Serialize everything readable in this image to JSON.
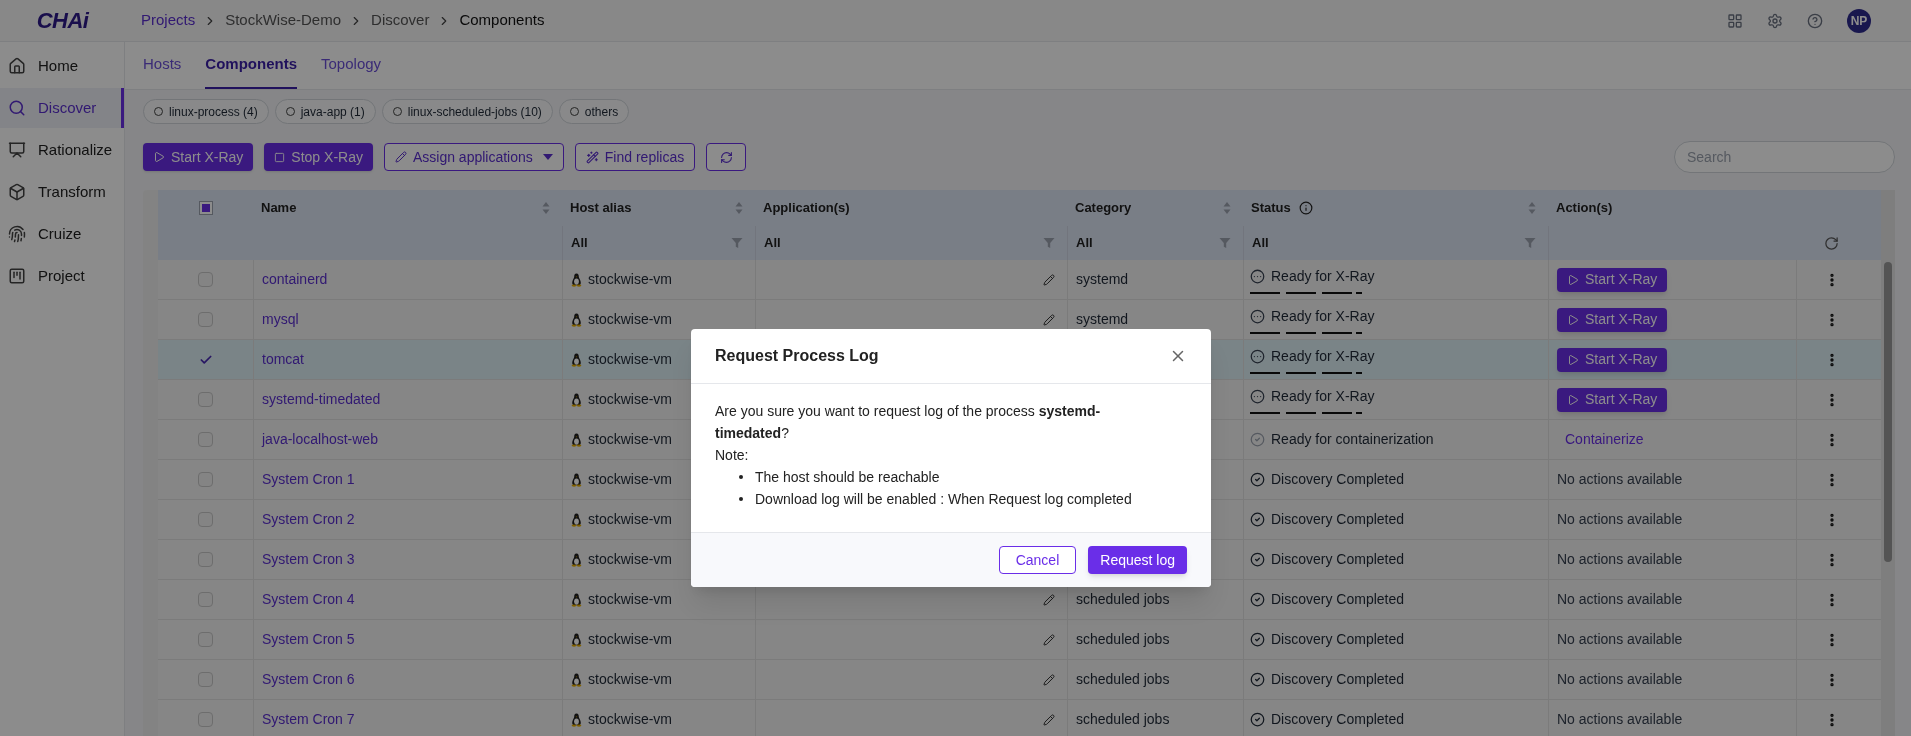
{
  "header": {
    "logo": "CHAi",
    "breadcrumb": [
      {
        "label": "Projects",
        "kind": "link"
      },
      {
        "label": "StockWise-Demo",
        "kind": "crumb"
      },
      {
        "label": "Discover",
        "kind": "crumb"
      },
      {
        "label": "Components",
        "kind": "current"
      }
    ],
    "avatar": "NP"
  },
  "sidebar": {
    "items": [
      {
        "label": "Home",
        "selected": false
      },
      {
        "label": "Discover",
        "selected": true
      },
      {
        "label": "Rationalize",
        "selected": false
      },
      {
        "label": "Transform",
        "selected": false
      },
      {
        "label": "Cruize",
        "selected": false
      },
      {
        "label": "Project",
        "selected": false
      }
    ]
  },
  "tabs": [
    {
      "label": "Hosts",
      "selected": false
    },
    {
      "label": "Components",
      "selected": true
    },
    {
      "label": "Topology",
      "selected": false
    }
  ],
  "filter_chips": [
    {
      "label": "linux-process (4)",
      "selected": false
    },
    {
      "label": "java-app (1)",
      "selected": false
    },
    {
      "label": "linux-scheduled-jobs (10)",
      "selected": false
    },
    {
      "label": "others",
      "selected": false
    }
  ],
  "toolbar": {
    "buttons": [
      {
        "label": "Start X-Ray",
        "kind": "play"
      },
      {
        "label": "Stop X-Ray",
        "kind": "stop"
      },
      {
        "label": "Assign applications",
        "kind": "dropdown"
      },
      {
        "label": "Find replicas",
        "kind": "wand"
      },
      {
        "kind": "refresh"
      }
    ],
    "search": {
      "placeholder": "Search"
    }
  },
  "table": {
    "select_all": {
      "indeterminate": true
    },
    "columns": [
      {
        "label": "Name",
        "sortable": true
      },
      {
        "label": "Host alias",
        "sortable": true,
        "filter": "All"
      },
      {
        "label": "Application(s)",
        "sortable": false,
        "filter": "All"
      },
      {
        "label": "Category",
        "sortable": true,
        "filter": "All"
      },
      {
        "label": "Status",
        "sortable": true,
        "filter": "All",
        "info": true
      },
      {
        "label": "Action(s)",
        "sortable": false
      }
    ],
    "rows": [
      {
        "name": "containerd",
        "checked": false,
        "host": "stockwise-vm",
        "category": "systemd",
        "status": {
          "label": "Ready for X-Ray",
          "kind": "pending"
        },
        "action": {
          "label": "Start X-Ray",
          "kind": "button"
        }
      },
      {
        "name": "mysql",
        "checked": false,
        "host": "stockwise-vm",
        "category": "systemd",
        "status": {
          "label": "Ready for X-Ray",
          "kind": "pending"
        },
        "action": {
          "label": "Start X-Ray",
          "kind": "button"
        }
      },
      {
        "name": "tomcat",
        "checked": true,
        "host": "stockwise-vm",
        "status": {
          "label": "Ready for X-Ray",
          "kind": "pending"
        },
        "action": {
          "label": "Start X-Ray",
          "kind": "button"
        }
      },
      {
        "name": "systemd-timedated",
        "checked": false,
        "host": "stockwise-vm",
        "status": {
          "label": "Ready for X-Ray",
          "kind": "pending"
        },
        "action": {
          "label": "Start X-Ray",
          "kind": "button"
        }
      },
      {
        "name": "java-localhost-web",
        "checked": false,
        "host": "stockwise-vm",
        "status": {
          "label": "Ready for containerization",
          "kind": "ready"
        },
        "action": {
          "label": "Containerize",
          "kind": "link"
        }
      },
      {
        "name": "System Cron 1",
        "checked": false,
        "host": "stockwise-vm",
        "status": {
          "label": "Discovery Completed",
          "kind": "done"
        },
        "action": {
          "label": "No actions available",
          "kind": "text"
        }
      },
      {
        "name": "System Cron 2",
        "checked": false,
        "host": "stockwise-vm",
        "status": {
          "label": "Discovery Completed",
          "kind": "done"
        },
        "action": {
          "label": "No actions available",
          "kind": "text"
        }
      },
      {
        "name": "System Cron 3",
        "checked": false,
        "host": "stockwise-vm",
        "status": {
          "label": "Discovery Completed",
          "kind": "done"
        },
        "action": {
          "label": "No actions available",
          "kind": "text"
        }
      },
      {
        "name": "System Cron 4",
        "checked": false,
        "host": "stockwise-vm",
        "category": "scheduled jobs",
        "status": {
          "label": "Discovery Completed",
          "kind": "done"
        },
        "action": {
          "label": "No actions available",
          "kind": "text"
        }
      },
      {
        "name": "System Cron 5",
        "checked": false,
        "host": "stockwise-vm",
        "category": "scheduled jobs",
        "status": {
          "label": "Discovery Completed",
          "kind": "done"
        },
        "action": {
          "label": "No actions available",
          "kind": "text"
        }
      },
      {
        "name": "System Cron 6",
        "checked": false,
        "host": "stockwise-vm",
        "category": "scheduled jobs",
        "status": {
          "label": "Discovery Completed",
          "kind": "done"
        },
        "action": {
          "label": "No actions available",
          "kind": "text"
        }
      },
      {
        "name": "System Cron 7",
        "checked": false,
        "host": "stockwise-vm",
        "category": "scheduled jobs",
        "status": {
          "label": "Discovery Completed",
          "kind": "done"
        },
        "action": {
          "label": "No actions available",
          "kind": "text"
        }
      }
    ]
  },
  "modal": {
    "title": "Request Process Log",
    "message": "Are you sure you want to request log of the process **systemd-timedated**?",
    "note_label": "Note:",
    "notes": [
      "The host should be reachable",
      "Download log will be enabled : When Request log completed"
    ],
    "buttons": [
      {
        "label": "Cancel",
        "kind": "outline"
      },
      {
        "label": "Request log",
        "kind": "primary"
      }
    ]
  }
}
